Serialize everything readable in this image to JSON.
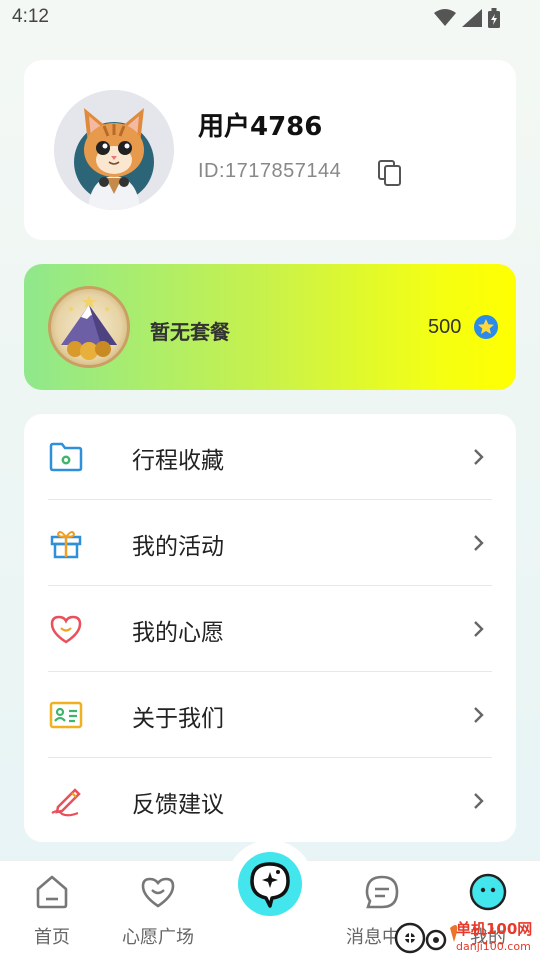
{
  "status_bar": {
    "time": "4:12",
    "icons": [
      "wifi-icon",
      "signal-icon",
      "battery-icon"
    ]
  },
  "profile": {
    "username": "用户4786",
    "user_id": "ID:1717857144",
    "avatar_icon": "cat-avatar"
  },
  "membership": {
    "status": "暂无套餐",
    "points": "500",
    "badge_icon": "mountain-badge-icon",
    "points_icon": "star-coin-icon"
  },
  "menu": {
    "items": [
      {
        "label": "行程收藏",
        "icon": "folder-icon"
      },
      {
        "label": "我的活动",
        "icon": "gift-icon"
      },
      {
        "label": "我的心愿",
        "icon": "heart-icon"
      },
      {
        "label": "关于我们",
        "icon": "id-card-icon"
      },
      {
        "label": "反馈建议",
        "icon": "pen-icon"
      }
    ]
  },
  "bottom_nav": {
    "items": [
      {
        "label": "首页",
        "icon": "home-icon"
      },
      {
        "label": "心愿广场",
        "icon": "heart-icon"
      },
      {
        "label": "消息中心",
        "icon": "message-icon"
      },
      {
        "label": "我的",
        "icon": "profile-icon"
      }
    ],
    "center_icon": "chat-bubble-sparkle-icon"
  },
  "watermark": {
    "line1": "单机100网",
    "line2": "danji100.com"
  },
  "colors": {
    "accent_cyan": "#43e6ec",
    "member_gradient_start": "#8fe88c",
    "member_gradient_end": "#ffff00",
    "menu_icon_blue": "#2f8fd8",
    "menu_icon_red": "#e9505a",
    "menu_icon_green": "#3fb56a"
  }
}
